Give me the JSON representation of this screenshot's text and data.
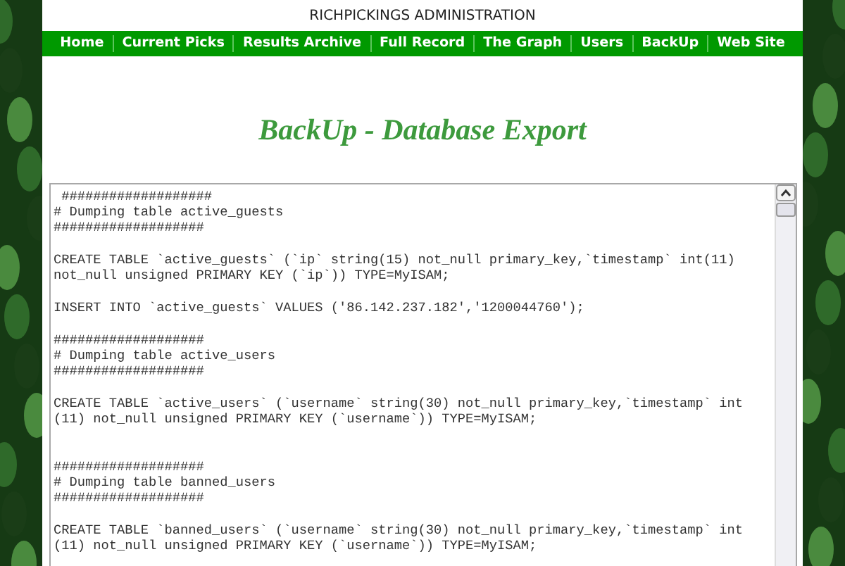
{
  "site_title": "RICHPICKINGS ADMINISTRATION",
  "nav": [
    "Home",
    "Current Picks",
    "Results Archive",
    "Full Record",
    "The Graph",
    "Users",
    "BackUp",
    "Web Site"
  ],
  "heading": "BackUp - Database Export",
  "export_text": [
    {
      "lines": [
        " ###################",
        "# Dumping table active_guests",
        "###################"
      ]
    },
    {
      "lines": [
        "CREATE TABLE `active_guests` (`ip` string(15) not_null primary_key,`timestamp` int(11)",
        "not_null unsigned PRIMARY KEY (`ip`)) TYPE=MyISAM;"
      ]
    },
    {
      "lines": [
        "INSERT INTO `active_guests` VALUES ('86.142.237.182','1200044760');"
      ]
    },
    {
      "lines": [
        "###################",
        "# Dumping table active_users",
        "###################"
      ]
    },
    {
      "lines": [
        "CREATE TABLE `active_users` (`username` string(30) not_null primary_key,`timestamp` int",
        "(11) not_null unsigned PRIMARY KEY (`username`)) TYPE=MyISAM;"
      ]
    },
    {
      "lines": [
        "###################",
        "# Dumping table banned_users",
        "###################"
      ]
    },
    {
      "lines": [
        "CREATE TABLE `banned_users` (`username` string(30) not_null primary_key,`timestamp` int",
        "(11) not_null unsigned PRIMARY KEY (`username`)) TYPE=MyISAM;"
      ]
    }
  ]
}
